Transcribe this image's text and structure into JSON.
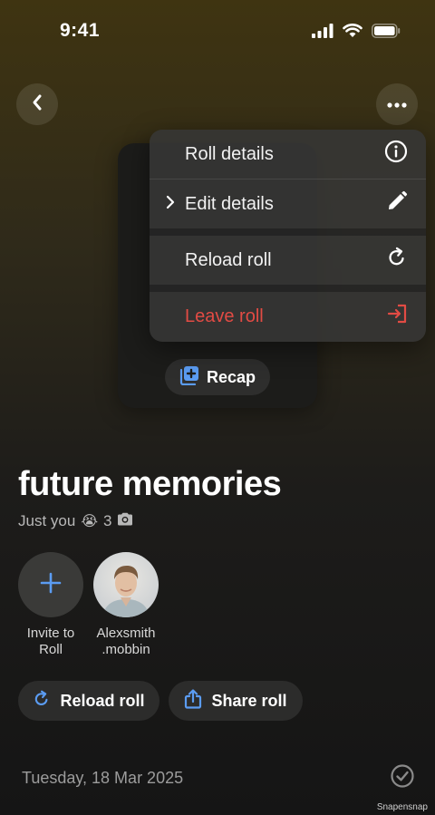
{
  "status": {
    "time": "9:41"
  },
  "menu": {
    "items": [
      {
        "label": "Roll details",
        "icon": "info-icon"
      },
      {
        "label": "Edit details",
        "icon": "pencil-icon"
      },
      {
        "label": "Reload roll",
        "icon": "reload-icon"
      },
      {
        "label": "Leave roll",
        "icon": "leave-icon",
        "color": "#e24b44"
      }
    ]
  },
  "card": {
    "recap_label": "Recap"
  },
  "roll": {
    "title": "future memories",
    "subtitle": "Just you",
    "emoji": "😭",
    "photo_count": "3"
  },
  "members": [
    {
      "label_line1": "Invite to",
      "label_line2": "Roll"
    },
    {
      "label_line1": "Alexsmith",
      "label_line2": ".mobbin"
    }
  ],
  "actions": {
    "reload_label": "Reload roll",
    "share_label": "Share roll"
  },
  "day": {
    "date": "Tuesday, 18 Mar 2025"
  },
  "watermark": "Snapensnap",
  "colors": {
    "accent": "#5b9cf2",
    "danger": "#e24b44"
  }
}
